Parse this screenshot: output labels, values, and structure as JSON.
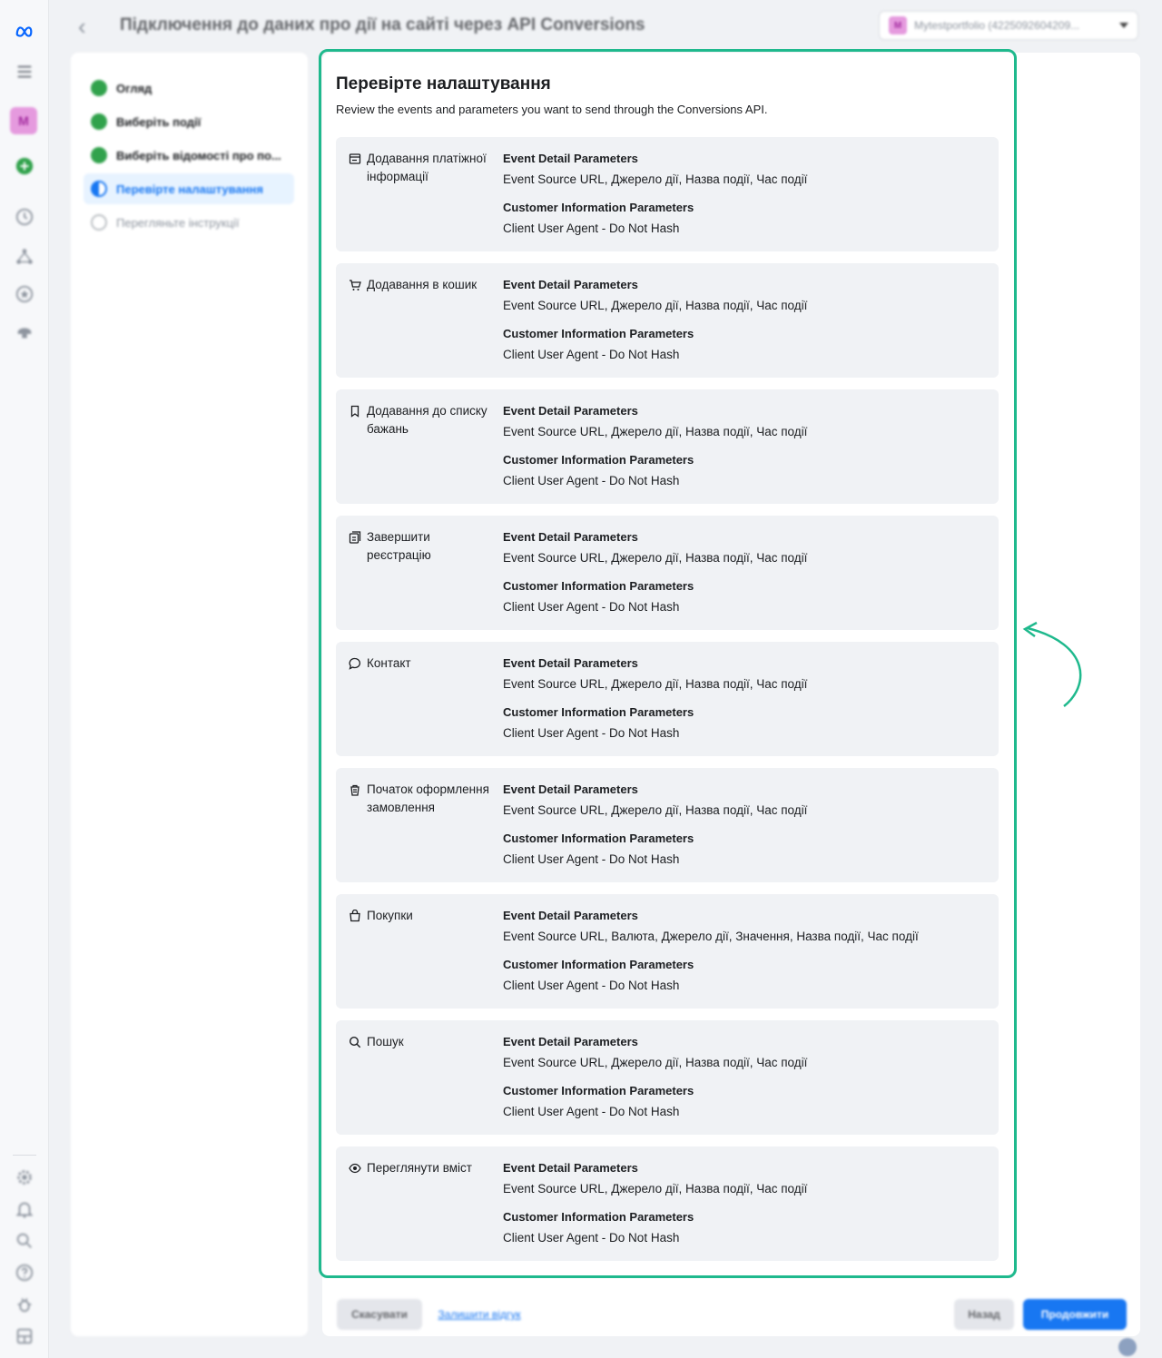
{
  "header": {
    "title": "Підключення до даних про дії на сайті через API Conversions",
    "account": "Mytestportfolio (4225092604209...",
    "account_initial": "M"
  },
  "leftnav": {
    "avatar_initial": "M"
  },
  "stepper": {
    "steps": [
      {
        "label": "Огляд",
        "state": "done"
      },
      {
        "label": "Виберіть події",
        "state": "done"
      },
      {
        "label": "Виберіть відомості про по...",
        "state": "done"
      },
      {
        "label": "Перевірте налаштування",
        "state": "active"
      },
      {
        "label": "Перегляньте інструкції",
        "state": "pending"
      }
    ]
  },
  "main": {
    "title": "Перевірте налаштування",
    "subtitle": "Review the events and parameters you want to send through the Conversions API.",
    "event_header": "Event Detail Parameters",
    "customer_header": "Customer Information Parameters",
    "events": [
      {
        "name": "Додавання платіжної інформації",
        "icon": "payment-card-icon",
        "event_params": "Event Source URL, Джерело дії, Назва події, Час події",
        "customer_params": "Client User Agent - Do Not Hash"
      },
      {
        "name": "Додавання в кошик",
        "icon": "cart-icon",
        "event_params": "Event Source URL, Джерело дії, Назва події, Час події",
        "customer_params": "Client User Agent - Do Not Hash"
      },
      {
        "name": "Додавання до списку бажань",
        "icon": "bookmark-icon",
        "event_params": "Event Source URL, Джерело дії, Назва події, Час події",
        "customer_params": "Client User Agent - Do Not Hash"
      },
      {
        "name": "Завершити реєстрацію",
        "icon": "registration-icon",
        "event_params": "Event Source URL, Джерело дії, Назва події, Час події",
        "customer_params": "Client User Agent - Do Not Hash"
      },
      {
        "name": "Контакт",
        "icon": "chat-bubble-icon",
        "event_params": "Event Source URL, Джерело дії, Назва події, Час події",
        "customer_params": "Client User Agent - Do Not Hash"
      },
      {
        "name": "Початок оформлення замовлення",
        "icon": "checkout-icon",
        "event_params": "Event Source URL, Джерело дії, Назва події, Час події",
        "customer_params": "Client User Agent - Do Not Hash"
      },
      {
        "name": "Покупки",
        "icon": "shopping-bag-icon",
        "event_params": "Event Source URL, Валюта, Джерело дії, Значення, Назва події, Час події",
        "customer_params": "Client User Agent - Do Not Hash"
      },
      {
        "name": "Пошук",
        "icon": "search-icon",
        "event_params": "Event Source URL, Джерело дії, Назва події, Час події",
        "customer_params": "Client User Agent - Do Not Hash"
      },
      {
        "name": "Переглянути вміст",
        "icon": "eye-icon",
        "event_params": "Event Source URL, Джерело дії, Назва події, Час події",
        "customer_params": "Client User Agent - Do Not Hash"
      }
    ]
  },
  "footer": {
    "cancel": "Скасувати",
    "report": "Залишити відгук",
    "back": "Назад",
    "next": "Продовжити"
  },
  "colors": {
    "accent": "#1877f2",
    "highlight": "#1fb98d",
    "done": "#31a24c"
  }
}
